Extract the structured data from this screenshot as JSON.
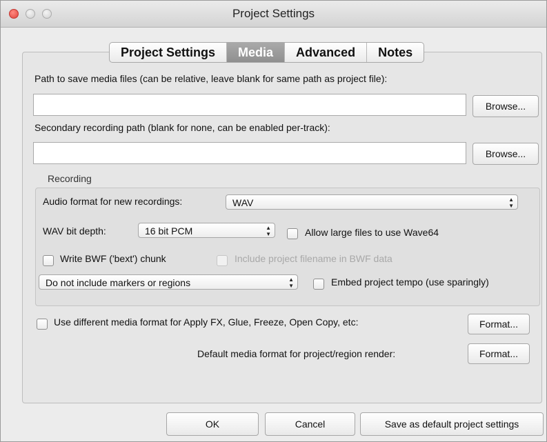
{
  "window": {
    "title": "Project Settings"
  },
  "tabs": [
    {
      "label": "Project Settings",
      "active": false
    },
    {
      "label": "Media",
      "active": true
    },
    {
      "label": "Advanced",
      "active": false
    },
    {
      "label": "Notes",
      "active": false
    }
  ],
  "media": {
    "path_label": "Path to save media files (can be relative, leave blank for same path as project file):",
    "path_value": "",
    "browse_label": "Browse...",
    "secondary_label": "Secondary recording path (blank for none, can be enabled per-track):",
    "secondary_value": "",
    "browse2_label": "Browse..."
  },
  "recording": {
    "group_label": "Recording",
    "audio_format_label": "Audio format for new recordings:",
    "audio_format_value": "WAV",
    "bit_depth_label": "WAV bit depth:",
    "bit_depth_value": "16 bit PCM",
    "wave64_label": "Allow large files to use Wave64",
    "wave64_checked": false,
    "bwf_label": "Write BWF ('bext') chunk",
    "bwf_checked": false,
    "include_filename_label": "Include project filename in BWF data",
    "include_filename_checked": false,
    "include_filename_enabled": false,
    "markers_value": "Do not include markers or regions",
    "embed_tempo_label": "Embed project tempo (use sparingly)",
    "embed_tempo_checked": false
  },
  "formats": {
    "different_format_label": "Use different media format for Apply FX, Glue, Freeze, Open Copy, etc:",
    "different_format_checked": false,
    "format_button_label": "Format...",
    "default_format_label": "Default media format for project/region render:",
    "format_button2_label": "Format..."
  },
  "buttons": {
    "ok": "OK",
    "cancel": "Cancel",
    "save_default": "Save as default project settings"
  },
  "colors": {
    "window_bg": "#ececec",
    "active_tab": "#9c9c9c",
    "close_light": "#e0443e"
  }
}
